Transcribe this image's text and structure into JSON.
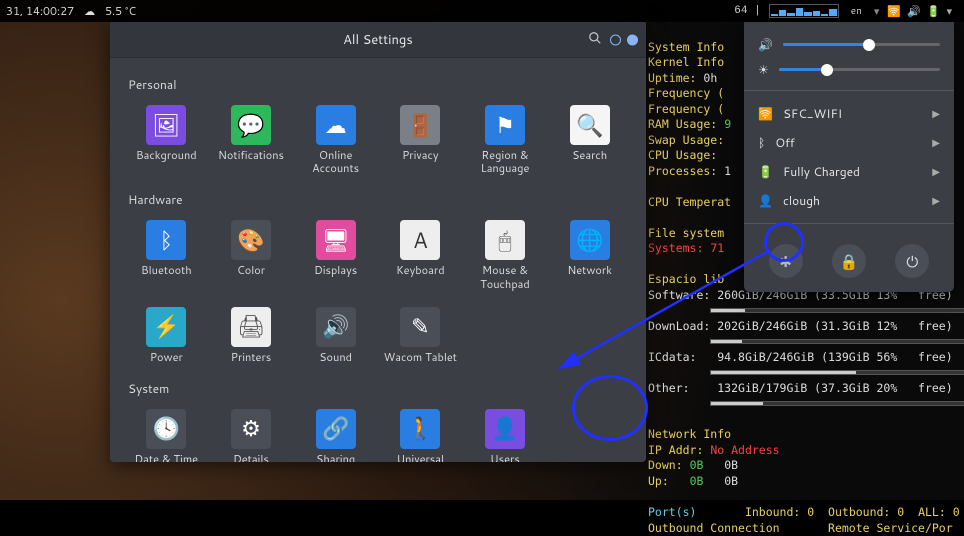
{
  "topbar": {
    "time": "31, 14:00:27",
    "temperature": "5.5 °C",
    "language": "en",
    "cpu_suffix": "64 |"
  },
  "settings": {
    "title": "All Settings",
    "sections": {
      "personal": {
        "label": "Personal",
        "items": [
          {
            "label": "Background"
          },
          {
            "label": "Notifications"
          },
          {
            "label": "Online Accounts"
          },
          {
            "label": "Privacy"
          },
          {
            "label": "Region & Language"
          },
          {
            "label": "Search"
          }
        ]
      },
      "hardware": {
        "label": "Hardware",
        "items": [
          {
            "label": "Bluetooth"
          },
          {
            "label": "Color"
          },
          {
            "label": "Displays"
          },
          {
            "label": "Keyboard"
          },
          {
            "label": "Mouse & Touchpad"
          },
          {
            "label": "Network"
          },
          {
            "label": "Power"
          },
          {
            "label": "Printers"
          },
          {
            "label": "Sound"
          },
          {
            "label": "Wacom Tablet"
          }
        ]
      },
      "system": {
        "label": "System",
        "items": [
          {
            "label": "Date & Time"
          },
          {
            "label": "Details"
          },
          {
            "label": "Sharing"
          },
          {
            "label": "Universal Access"
          },
          {
            "label": "Users"
          }
        ]
      }
    }
  },
  "sysmenu": {
    "volume_pct": 55,
    "brightness_pct": 30,
    "items": [
      {
        "icon": "wifi",
        "label": "SFC_WIFI"
      },
      {
        "icon": "bluetooth",
        "label": "Off"
      },
      {
        "icon": "battery",
        "label": "Fully Charged"
      },
      {
        "icon": "user",
        "label": "clough"
      }
    ]
  },
  "conky": {
    "header_sys": "System Info",
    "header_kernel": "Kernel Info",
    "uptime_label": "Uptime:",
    "uptime_val": "0h",
    "freq_label": "Frequency (",
    "ram_label": "RAM Usage:",
    "swap_label": "Swap Usage:",
    "cpu_label": "CPU Usage:",
    "proc_label": "Processes:",
    "cputemp_label": "CPU Temperat",
    "fs_label": "File system",
    "systems_label": "Systems:",
    "systems_val": "71",
    "espacio_label": "Espacio lib",
    "rows": [
      {
        "name": "Software:",
        "text": "260GiB/246GiB (33.5GiB 13%   free)",
        "pct": 13
      },
      {
        "name": "DownLoad:",
        "text": "202GiB/246GiB (31.3GiB 12%   free)",
        "pct": 12
      },
      {
        "name": "ICdata:",
        "text": "94.8GiB/246GiB (139GiB 56%   free)",
        "pct": 56
      },
      {
        "name": "Other:",
        "text": "132GiB/179GiB (37.3GiB 20%   free)",
        "pct": 20
      }
    ],
    "net_header": "Network Info",
    "ip_label": "IP Addr:",
    "ip_val": "No Address",
    "down_label": "Down:",
    "down_v1": "0B",
    "down_v2": "0B",
    "up_label": "Up:",
    "up_v1": "0B",
    "up_v2": "0B",
    "ports_label": "Port(s)",
    "inbound": "Inbound: 0",
    "outbound": "Outbound: 0",
    "all": "ALL: 0",
    "outconn": "Outbound Connection",
    "remote": "Remote Service/Por"
  }
}
